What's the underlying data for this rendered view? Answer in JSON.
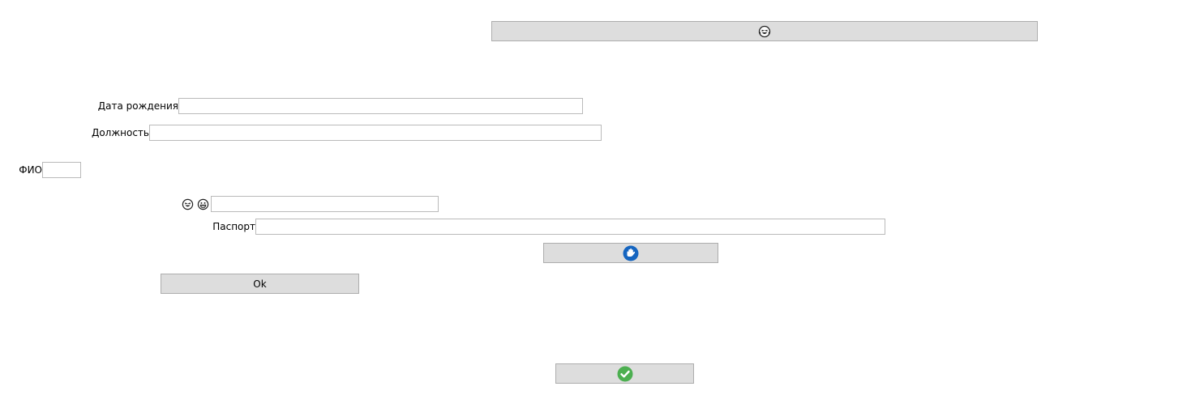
{
  "form": {
    "birth_date_label": "Дата рождения",
    "birth_date_value": "",
    "position_label": "Должность",
    "position_value": "",
    "fio_label": "ФИО",
    "fio_value": "",
    "emoji_field_value": "",
    "passport_label": "Паспорт",
    "passport_value": ""
  },
  "buttons": {
    "top_button_icon": "laughing-face-icon",
    "ok_label": "Ok",
    "middle_button_icon": "blue-circle-hand-icon",
    "bottom_button_icon": "green-check-icon"
  },
  "emoji_labels": [
    "laughing-face-icon",
    "grinning-face-icon"
  ],
  "colors": {
    "button_bg": "#dddddd",
    "button_border": "#adadad",
    "field_border": "#bababa",
    "check_green": "#4caf50",
    "hand_blue": "#1565c0"
  }
}
